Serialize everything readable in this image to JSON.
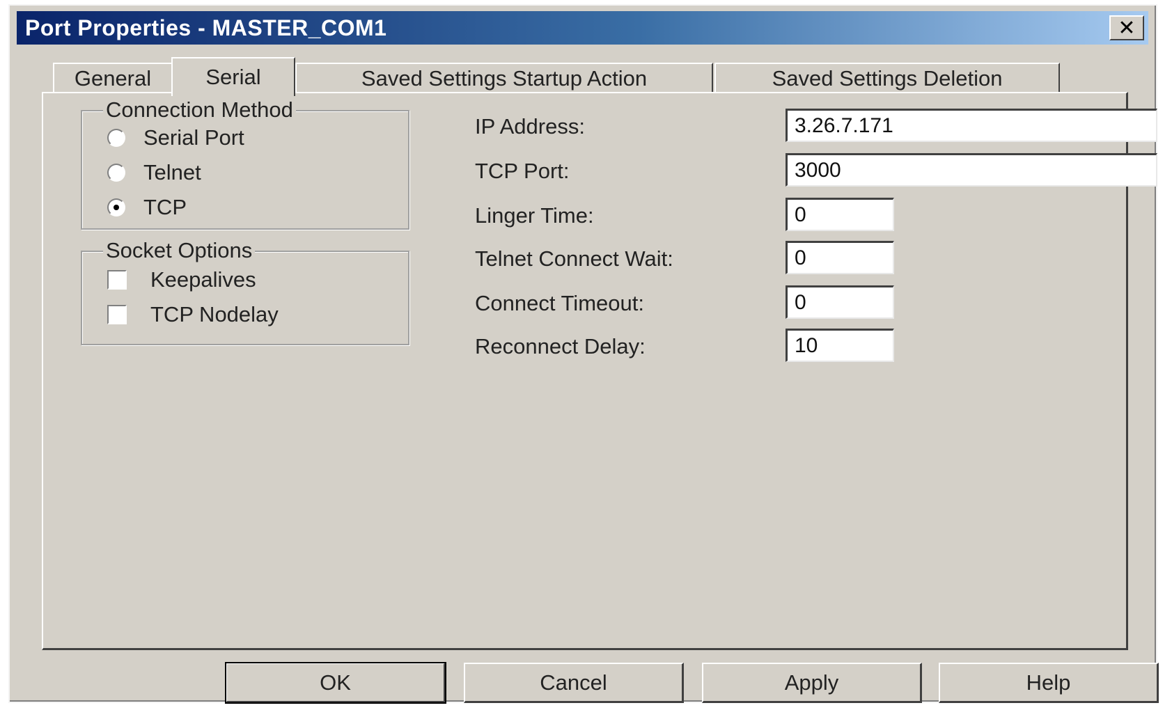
{
  "window": {
    "title": "Port Properties - MASTER_COM1",
    "close_label": "✕"
  },
  "tabs": [
    {
      "label": "General",
      "active": false
    },
    {
      "label": "Serial",
      "active": true
    },
    {
      "label": "Saved Settings Startup Action",
      "active": false
    },
    {
      "label": "Saved Settings Deletion",
      "active": false
    }
  ],
  "connection_method": {
    "title": "Connection Method",
    "options": [
      {
        "label": "Serial Port",
        "checked": false
      },
      {
        "label": "Telnet",
        "checked": false
      },
      {
        "label": "TCP",
        "checked": true
      }
    ]
  },
  "socket_options": {
    "title": "Socket Options",
    "options": [
      {
        "label": "Keepalives",
        "checked": false
      },
      {
        "label": "TCP Nodelay",
        "checked": false
      }
    ]
  },
  "fields": {
    "ip_address": {
      "label": "IP Address:",
      "value": "3.26.7.171"
    },
    "tcp_port": {
      "label": "TCP Port:",
      "value": "3000"
    },
    "linger_time": {
      "label": "Linger Time:",
      "value": "0"
    },
    "telnet_connect_wait": {
      "label": "Telnet Connect Wait:",
      "value": "0"
    },
    "connect_timeout": {
      "label": "Connect Timeout:",
      "value": "0"
    },
    "reconnect_delay": {
      "label": "Reconnect Delay:",
      "value": "10"
    }
  },
  "buttons": {
    "ok": "OK",
    "cancel": "Cancel",
    "apply": "Apply",
    "help": "Help"
  }
}
